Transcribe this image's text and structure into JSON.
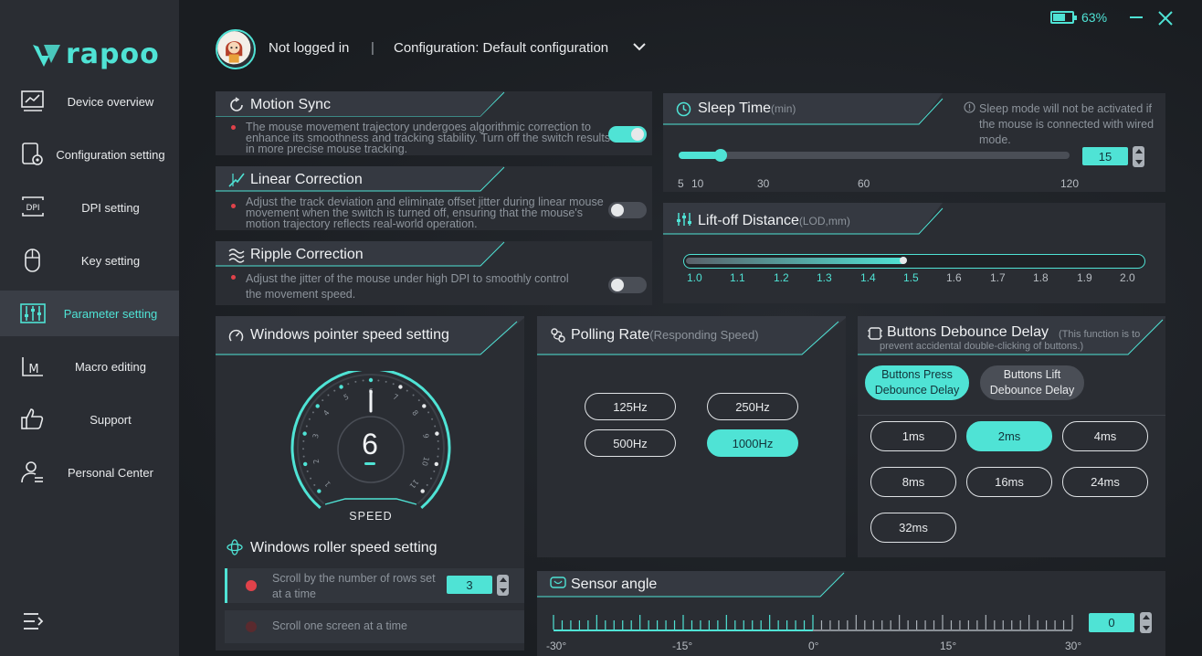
{
  "brand": {
    "name": "rapoo"
  },
  "sidebar": {
    "items": [
      {
        "label": "Device overview",
        "icon": "monitor-chart-icon"
      },
      {
        "label": "Configuration setting",
        "icon": "config-gear-icon"
      },
      {
        "label": "DPI setting",
        "icon": "dpi-icon"
      },
      {
        "label": "Key setting",
        "icon": "mouse-icon"
      },
      {
        "label": "Parameter setting",
        "icon": "sliders-icon",
        "active": true
      },
      {
        "label": "Macro editing",
        "icon": "macro-icon"
      },
      {
        "label": "Support",
        "icon": "thumbs-up-icon"
      },
      {
        "label": "Personal Center",
        "icon": "user-icon"
      }
    ]
  },
  "header": {
    "login_status": "Not logged in",
    "separator": "|",
    "configuration": "Configuration: Default configuration",
    "battery": "63%",
    "battery_level": 0.63
  },
  "motion_sync": {
    "title": "Motion Sync",
    "desc": "The mouse movement trajectory undergoes algorithmic correction to enhance its smoothness and tracking stability. Turn off the switch results in more precise mouse tracking.",
    "enabled": true
  },
  "linear_correction": {
    "title": "Linear Correction",
    "desc": "Adjust the track deviation and eliminate offset jitter during linear mouse movement when the switch is turned off, ensuring that the mouse's motion trajectory reflects real-world operation.",
    "enabled": false
  },
  "ripple_correction": {
    "title": "Ripple Correction",
    "desc": "Adjust the jitter of the mouse under high DPI to smoothly control the movement speed.",
    "enabled": false
  },
  "sleep_time": {
    "title": "Sleep Time",
    "unit": "(min)",
    "note": "Sleep mode will not be activated if the mouse is connected with wired mode.",
    "value": "15",
    "value_num": 15,
    "min": 5,
    "max": 120,
    "ticks": [
      "5",
      "10",
      "30",
      "60",
      "120"
    ]
  },
  "lift_off": {
    "title": "Lift-off Distance",
    "unit": "(LOD,mm)",
    "value": 1.5,
    "ticks": [
      "1.0",
      "1.1",
      "1.2",
      "1.3",
      "1.4",
      "1.5",
      "1.6",
      "1.7",
      "1.8",
      "1.9",
      "2.0"
    ]
  },
  "pointer_speed": {
    "title": "Windows pointer speed setting",
    "value": "6",
    "caption": "SPEED",
    "dial_labels": [
      "1",
      "2",
      "3",
      "4",
      "5",
      "6",
      "7",
      "8",
      "9",
      "10",
      "11"
    ]
  },
  "roller_speed": {
    "title": "Windows roller speed setting",
    "option_rows": "Scroll by the number of rows set at a time",
    "rows_value": "3",
    "option_screen": "Scroll one screen at a time"
  },
  "polling_rate": {
    "title": "Polling Rate",
    "sub": "(Responding Speed)",
    "options": [
      "125Hz",
      "250Hz",
      "500Hz",
      "1000Hz"
    ],
    "selected": "1000Hz"
  },
  "debounce": {
    "title": "Buttons Debounce Delay",
    "sub": "(This function is to prevent accidental double-clicking of buttons.)",
    "tab_press": "Buttons Press Debounce Delay",
    "tab_lift": "Buttons Lift Debounce Delay",
    "options": [
      "1ms",
      "2ms",
      "4ms",
      "8ms",
      "16ms",
      "24ms",
      "32ms"
    ],
    "selected": "2ms"
  },
  "sensor_angle": {
    "title": "Sensor angle",
    "value": "0",
    "ticks": [
      "-30°",
      "-15°",
      "0°",
      "15°",
      "30°"
    ]
  },
  "colors": {
    "accent": "#4fe3d5",
    "sidebar": "#2a2d33",
    "card": "#2a2d33"
  }
}
